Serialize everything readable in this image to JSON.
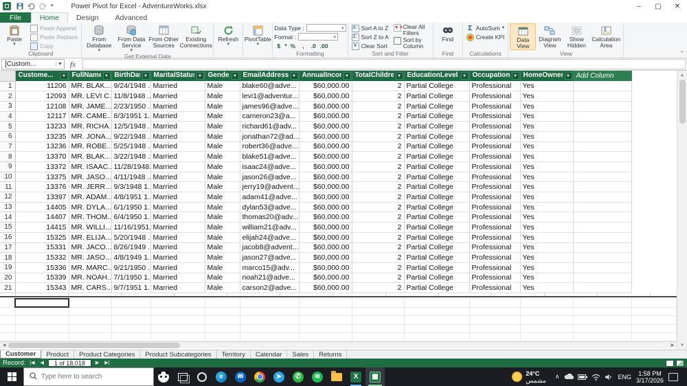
{
  "titlebar": {
    "title": "Power Pivot for Excel - AdventureWorks.xlsx"
  },
  "ribbon_tabs": {
    "file": "File",
    "home": "Home",
    "design": "Design",
    "advanced": "Advanced"
  },
  "ribbon": {
    "clipboard": {
      "label": "Clipboard",
      "paste": "Paste",
      "paste_append": "Paste Append",
      "paste_replace": "Paste Replace",
      "copy": "Copy"
    },
    "external": {
      "label": "Get External Data",
      "from_database": "From Database",
      "from_data_service": "From Data Service",
      "from_other_sources": "From Other Sources",
      "existing_connections": "Existing Connections"
    },
    "refresh": "Refresh",
    "pivottable": "PivotTable",
    "formatting": {
      "label": "Formatting",
      "data_type": "Data Type :",
      "format": "Format :",
      "buttons": [
        "$",
        "%",
        ",",
        ".0",
        ".00"
      ]
    },
    "sort": {
      "label": "Sort and Filter",
      "sort_az": "Sort A to Z",
      "sort_za": "Sort Z to A",
      "clear_sort": "Clear Sort",
      "clear_filters": "Clear All Filters",
      "sort_by_column": "Sort by Column"
    },
    "find": {
      "label": "Find",
      "find": "Find"
    },
    "calculations": {
      "label": "Calculations",
      "autosum": "AutoSum",
      "create_kpi": "Create KPI"
    },
    "view": {
      "label": "View",
      "data_view": "Data View",
      "diagram_view": "Diagram View",
      "show_hidden": "Show Hidden",
      "calculation_area": "Calculation Area"
    }
  },
  "formula_bar": {
    "name_box": "[Custom...",
    "fx": "fx"
  },
  "table": {
    "headers": [
      "Custome...",
      "FullName",
      "BirthDate",
      "MaritalStatus",
      "Gender",
      "EmailAddress",
      "AnnualIncome",
      "TotalChildren",
      "EducationLevel",
      "Occupation",
      "HomeOwner"
    ],
    "add_column": "Add Column",
    "rows": [
      [
        "11206",
        "MR. BLAK...",
        "9/24/1948 ...",
        "Married",
        "Male",
        "blake60@adve...",
        "$60,000.00",
        "2",
        "Partial College",
        "Professional",
        "Yes"
      ],
      [
        "12093",
        "MR. LEVI C...",
        "11/8/1948 ...",
        "Married",
        "Male",
        "levi1@adventur...",
        "$60,000.00",
        "2",
        "Partial College",
        "Professional",
        "Yes"
      ],
      [
        "12108",
        "MR. JAME...",
        "2/23/1950 ...",
        "Married",
        "Male",
        "james96@adve...",
        "$60,000.00",
        "2",
        "Partial College",
        "Professional",
        "Yes"
      ],
      [
        "12117",
        "MR. CAME...",
        "8/3/1951 1...",
        "Married",
        "Male",
        "cameron23@a...",
        "$60,000.00",
        "2",
        "Partial College",
        "Professional",
        "Yes"
      ],
      [
        "13233",
        "MR. RICHA...",
        "12/5/1948 ...",
        "Married",
        "Male",
        "richard61@adv...",
        "$60,000.00",
        "2",
        "Partial College",
        "Professional",
        "Yes"
      ],
      [
        "13235",
        "MR. JONA...",
        "9/22/1948 ...",
        "Married",
        "Male",
        "jonathan72@ad...",
        "$60,000.00",
        "2",
        "Partial College",
        "Professional",
        "Yes"
      ],
      [
        "13236",
        "MR. ROBE...",
        "5/25/1948 ...",
        "Married",
        "Male",
        "robert36@adve...",
        "$60,000.00",
        "2",
        "Partial College",
        "Professional",
        "Yes"
      ],
      [
        "13370",
        "MR. BLAK...",
        "3/22/1948 ...",
        "Married",
        "Male",
        "blake51@adve...",
        "$60,000.00",
        "2",
        "Partial College",
        "Professional",
        "Yes"
      ],
      [
        "13372",
        "MR. ISAAC...",
        "11/28/1948...",
        "Married",
        "Male",
        "isaac24@adve...",
        "$60,000.00",
        "2",
        "Partial College",
        "Professional",
        "Yes"
      ],
      [
        "13375",
        "MR. JASO...",
        "4/11/1948 ...",
        "Married",
        "Male",
        "jason26@adve...",
        "$60,000.00",
        "2",
        "Partial College",
        "Professional",
        "Yes"
      ],
      [
        "13376",
        "MR. JERR...",
        "9/3/1948 1...",
        "Married",
        "Male",
        "jerry19@advent...",
        "$60,000.00",
        "2",
        "Partial College",
        "Professional",
        "Yes"
      ],
      [
        "13397",
        "MR. ADAM...",
        "4/8/1951 1...",
        "Married",
        "Male",
        "adam41@adve...",
        "$60,000.00",
        "2",
        "Partial College",
        "Professional",
        "Yes"
      ],
      [
        "14405",
        "MR. DYLA...",
        "6/1/1950 1...",
        "Married",
        "Male",
        "dylan53@adve...",
        "$60,000.00",
        "2",
        "Partial College",
        "Professional",
        "Yes"
      ],
      [
        "14407",
        "MR. THOM...",
        "6/4/1950 1...",
        "Married",
        "Male",
        "thomas20@adv...",
        "$60,000.00",
        "2",
        "Partial College",
        "Professional",
        "Yes"
      ],
      [
        "14415",
        "MR. WILLI...",
        "11/16/1951...",
        "Married",
        "Male",
        "william21@adv...",
        "$60,000.00",
        "2",
        "Partial College",
        "Professional",
        "Yes"
      ],
      [
        "15325",
        "MR. ELIJA...",
        "5/20/1948 ...",
        "Married",
        "Male",
        "elijah24@adve...",
        "$60,000.00",
        "2",
        "Partial College",
        "Professional",
        "Yes"
      ],
      [
        "15331",
        "MR. JACO...",
        "8/26/1949 ...",
        "Married",
        "Male",
        "jacob8@advent...",
        "$60,000.00",
        "2",
        "Partial College",
        "Professional",
        "Yes"
      ],
      [
        "15332",
        "MR. JASO...",
        "4/8/1949 1...",
        "Married",
        "Male",
        "jason27@adve...",
        "$60,000.00",
        "2",
        "Partial College",
        "Professional",
        "Yes"
      ],
      [
        "15336",
        "MR. MARC...",
        "9/21/1950 ...",
        "Married",
        "Male",
        "marco15@adv...",
        "$60,000.00",
        "2",
        "Partial College",
        "Professional",
        "Yes"
      ],
      [
        "15339",
        "MR. NOAH...",
        "7/1/1950 1...",
        "Married",
        "Male",
        "noah21@adve...",
        "$60,000.00",
        "2",
        "Partial College",
        "Professional",
        "Yes"
      ],
      [
        "15343",
        "MR. CARS...",
        "9/7/1951 1...",
        "Married",
        "Male",
        "carson2@adve...",
        "$60,000.00",
        "2",
        "Partial College",
        "Professional",
        "Yes"
      ]
    ]
  },
  "sheet_tabs": [
    "Customer",
    "Product",
    "Product Categories",
    "Product Subcategories",
    "Territory",
    "Calendar",
    "Sales",
    "Returns"
  ],
  "status_bar": {
    "record_label": "Record:",
    "position": "1 of 18,018"
  },
  "taskbar": {
    "search_placeholder": "Type here to search",
    "weather_temp": "24°C",
    "weather_desc": "مشمس",
    "lang": "ENG",
    "time": "1:58 PM",
    "date": "3/17/2026"
  }
}
